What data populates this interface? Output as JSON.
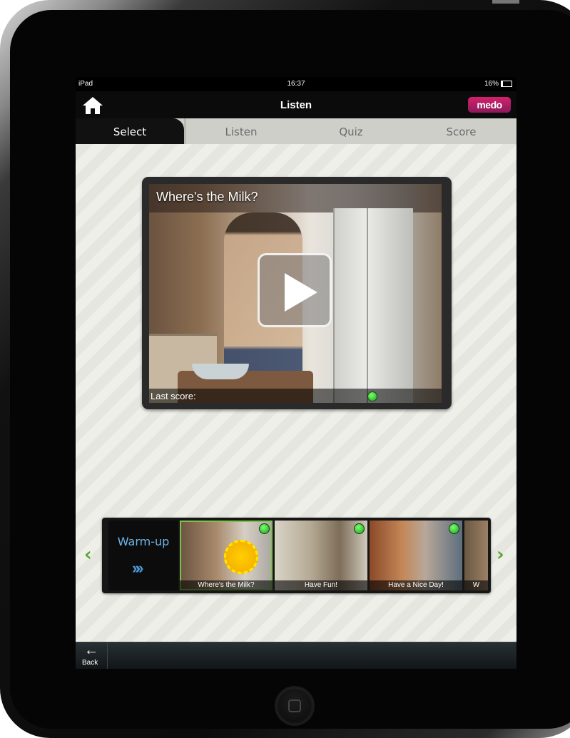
{
  "status_bar": {
    "device": "iPad",
    "time": "16:37",
    "battery": "16%"
  },
  "nav": {
    "title": "Listen",
    "logo_text": "medo"
  },
  "tabs": [
    {
      "label": "Select",
      "active": true
    },
    {
      "label": "Listen",
      "active": false
    },
    {
      "label": "Quiz",
      "active": false
    },
    {
      "label": "Score",
      "active": false
    }
  ],
  "video": {
    "title": "Where's the Milk?",
    "last_score_label": "Last score:"
  },
  "carousel": {
    "warmup_label": "Warm-up",
    "warmup_icon": "»»",
    "items": [
      {
        "caption": "Where's the Milk?",
        "selected": true,
        "completed": true
      },
      {
        "caption": "Have Fun!",
        "selected": false,
        "completed": true
      },
      {
        "caption": "Have a Nice Day!",
        "selected": false,
        "completed": true
      },
      {
        "caption": "W",
        "selected": false,
        "completed": false
      }
    ]
  },
  "toolbar": {
    "back_label": "Back"
  },
  "colors": {
    "accent_green": "#5ba436",
    "warmup_blue": "#6fb4e8",
    "brand": "#d5216c"
  }
}
